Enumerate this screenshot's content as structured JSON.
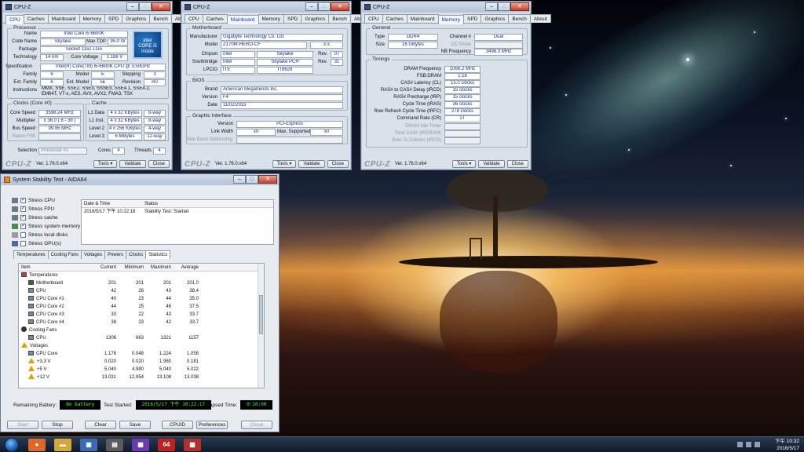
{
  "cpuz_common": {
    "tabs": [
      "CPU",
      "Caches",
      "Mainboard",
      "Memory",
      "SPD",
      "Graphics",
      "Bench",
      "About"
    ],
    "logo": "CPU-Z",
    "version": "Ver. 1.76.0.x64",
    "tools": "Tools",
    "validate": "Validate",
    "close": "Close",
    "window_title": "CPU-Z"
  },
  "cpu": {
    "processor_group": "Processor",
    "name_label": "Name",
    "name": "Intel Core i5 6600K",
    "codename_label": "Code Name",
    "codename": "Skylake",
    "maxtdp_label": "Max TDP",
    "maxtdp": "95.0 W",
    "package_label": "Package",
    "package": "Socket 1151 LGA",
    "technology_label": "Technology",
    "technology": "14 nm",
    "corevoltage_label": "Core Voltage",
    "corevoltage": "1.188 V",
    "spec_label": "Specification",
    "spec": "Intel(R) Core(TM) i5-6600K CPU @ 3.50GHz",
    "family_label": "Family",
    "family": "6",
    "model_label": "Model",
    "model": "E",
    "stepping_label": "Stepping",
    "stepping": "3",
    "extfamily_label": "Ext. Family",
    "extfamily": "6",
    "extmodel_label": "Ext. Model",
    "extmodel": "5E",
    "revision_label": "Revision",
    "revision": "R0",
    "instructions_label": "Instructions",
    "instructions": "MMX, SSE, SSE2, SSE3, SSSE3, SSE4.1, SSE4.2, EM64T, VT-x, AES, AVX, AVX2, FMA3, TSX",
    "intel_logo_line1": "intel",
    "intel_logo_line2": "CORE i5",
    "intel_logo_line3": "inside",
    "clocks_group": "Clocks (Core #0)",
    "corespeed_label": "Core Speed",
    "corespeed": "3598.24 MHz",
    "multiplier_label": "Multiplier",
    "multiplier": "x 36.0 ( 8 - 39 )",
    "busspeed_label": "Bus Speed",
    "busspeed": "99.95 MHz",
    "ratedfsb_label": "Rated FSB",
    "cache_group": "Cache",
    "l1data_label": "L1 Data",
    "l1data": "4 x 32 KBytes",
    "l1data_way": "8-way",
    "l1inst_label": "L1 Inst.",
    "l1inst": "4 x 32 KBytes",
    "l1inst_way": "8-way",
    "l2_label": "Level 2",
    "l2": "4 x 256 KBytes",
    "l2_way": "4-way",
    "l3_label": "Level 3",
    "l3": "6 MBytes",
    "l3_way": "12-way",
    "selection_label": "Selection",
    "selection": "Processor #1",
    "cores_label": "Cores",
    "cores": "4",
    "threads_label": "Threads",
    "threads": "4"
  },
  "mainboard": {
    "mb_group": "Motherboard",
    "manufacturer_label": "Manufacturer",
    "manufacturer": "Gigabyte Technology Co. Ltd.",
    "model_label": "Model",
    "model": "Z170M-HERO-CF",
    "model_rev": "x.x",
    "chipset_label": "Chipset",
    "chipset_vendor": "Intel",
    "chipset": "Skylake",
    "chipset_rev_label": "Rev.",
    "chipset_rev": "07",
    "southbridge_label": "Southbridge",
    "sb_vendor": "Intel",
    "sb": "Skylake PCH",
    "sb_rev_label": "Rev.",
    "sb_rev": "31",
    "lpcio_label": "LPCIO",
    "lpcio_vendor": "ITE",
    "lpcio": "IT8628",
    "bios_group": "BIOS",
    "brand_label": "Brand",
    "brand": "American Megatrends Inc.",
    "version_label": "Version",
    "version": "F4",
    "date_label": "Date",
    "date": "11/02/2015",
    "gi_group": "Graphic Interface",
    "gi_version_label": "Version",
    "gi_version": "PCI-Express",
    "linkwidth_label": "Link Width",
    "linkwidth": "x0",
    "maxsupported_label": "Max. Supported",
    "maxsupported": "x0",
    "sideband_label": "Side Band Addressing"
  },
  "memory": {
    "general_group": "General",
    "type_label": "Type",
    "type": "DDR4",
    "channel_label": "Channel #",
    "channel": "Dual",
    "size_label": "Size",
    "size": "16 GBytes",
    "dcmode_label": "DC Mode",
    "nbfreq_label": "NB Frequency",
    "nbfreq": "3498.3 MHz",
    "timings_group": "Timings",
    "timings": [
      {
        "label": "DRAM Frequency",
        "value": "1066.2 MHz"
      },
      {
        "label": "FSB:DRAM",
        "value": "1:16"
      },
      {
        "label": "CAS# Latency (CL)",
        "value": "15.0 clocks"
      },
      {
        "label": "RAS# to CAS# Delay (tRCD)",
        "value": "15 clocks"
      },
      {
        "label": "RAS# Precharge (tRP)",
        "value": "15 clocks"
      },
      {
        "label": "Cycle Time (tRAS)",
        "value": "36 clocks"
      },
      {
        "label": "Row Refresh Cycle Time (tRFC)",
        "value": "278 clocks"
      },
      {
        "label": "Command Rate (CR)",
        "value": "2T"
      }
    ],
    "disabled_timings": [
      "DRAM Idle Timer",
      "Total CAS# (tRDRAM)",
      "Row To Column (tRCD)"
    ]
  },
  "aida": {
    "title": "System Stability Test - AIDA64",
    "checks": [
      {
        "label": "Stress CPU",
        "checked": true
      },
      {
        "label": "Stress FPU",
        "checked": true
      },
      {
        "label": "Stress cache",
        "checked": true
      },
      {
        "label": "Stress system memory",
        "checked": true
      },
      {
        "label": "Stress local disks",
        "checked": false
      },
      {
        "label": "Stress GPU(s)",
        "checked": false
      }
    ],
    "log_headers": [
      "Date & Time",
      "Status"
    ],
    "log_rows": [
      {
        "time": "2016/5/17 下午 10:22:18",
        "status": "Stability Test: Started"
      }
    ],
    "tabs": [
      "Temperatures",
      "Cooling Fans",
      "Voltages",
      "Powers",
      "Clocks",
      "Statistics"
    ],
    "stat_headers": [
      "Item",
      "Current",
      "Minimum",
      "Maximum",
      "Average"
    ],
    "stats": [
      {
        "kind": "section",
        "icon": "thermometer",
        "item": "Temperatures"
      },
      {
        "kind": "row",
        "icon": "motherboard",
        "item": "Motherboard",
        "cur": "201",
        "min": "201",
        "max": "201",
        "avg": "201.0"
      },
      {
        "kind": "row",
        "icon": "chip",
        "item": "CPU",
        "cur": "42",
        "min": "26",
        "max": "43",
        "avg": "38.4"
      },
      {
        "kind": "row",
        "icon": "chip",
        "item": "CPU Core #1",
        "cur": "40",
        "min": "23",
        "max": "44",
        "avg": "35.0"
      },
      {
        "kind": "row",
        "icon": "chip",
        "item": "CPU Core #2",
        "cur": "44",
        "min": "25",
        "max": "46",
        "avg": "37.5"
      },
      {
        "kind": "row",
        "icon": "chip",
        "item": "CPU Core #3",
        "cur": "33",
        "min": "22",
        "max": "43",
        "avg": "33.7"
      },
      {
        "kind": "row",
        "icon": "chip",
        "item": "CPU Core #4",
        "cur": "38",
        "min": "23",
        "max": "42",
        "avg": "33.7"
      },
      {
        "kind": "section",
        "icon": "fan",
        "item": "Cooling Fans"
      },
      {
        "kind": "row",
        "icon": "chip",
        "item": "CPU",
        "cur": "1306",
        "min": "663",
        "max": "1321",
        "avg": "1157"
      },
      {
        "kind": "section",
        "icon": "warning",
        "item": "Voltages"
      },
      {
        "kind": "row",
        "icon": "chip",
        "item": "CPU Core",
        "cur": "1.176",
        "min": "0.048",
        "max": "1.224",
        "avg": "1.058"
      },
      {
        "kind": "row",
        "icon": "warning",
        "item": "+3.3 V",
        "cur": "0.020",
        "min": "0.020",
        "max": "1.960",
        "avg": "0.181"
      },
      {
        "kind": "row",
        "icon": "warning",
        "item": "+5 V",
        "cur": "5.040",
        "min": "4.980",
        "max": "5.040",
        "avg": "5.022"
      },
      {
        "kind": "row",
        "icon": "warning",
        "item": "+12 V",
        "cur": "13.031",
        "min": "12.954",
        "max": "13.108",
        "avg": "13.038"
      }
    ],
    "battery_label": "Remaining Battery:",
    "battery": "No battery",
    "started_label": "Test Started:",
    "started": "2016/5/17 下午 10:22:17",
    "elapsed_label": "Elapsed Time:",
    "elapsed": "0:10:00",
    "buttons": {
      "start": "Start",
      "stop": "Stop",
      "clear": "Clear",
      "save": "Save",
      "cpuid": "CPUID",
      "preferences": "Preferences",
      "close": "Close"
    }
  },
  "taskbar": {
    "apps": [
      {
        "name": "firefox-icon",
        "color": "#e0662a",
        "glyph": "●"
      },
      {
        "name": "explorer-icon",
        "color": "#d4a93a",
        "glyph": "▬"
      },
      {
        "name": "network-icon",
        "color": "#3a6ab0",
        "glyph": "▣"
      },
      {
        "name": "cpuz-taskbar-icon",
        "color": "#5a5a5a",
        "glyph": "▤"
      },
      {
        "name": "processor-icon",
        "color": "#6a3ab0",
        "glyph": "▦"
      },
      {
        "name": "aida64-taskbar-icon",
        "color": "#c02020",
        "glyph": "64"
      },
      {
        "name": "app-icon",
        "color": "#b03030",
        "glyph": "▩"
      }
    ],
    "time": "下午 10:32",
    "date": "2016/5/17"
  }
}
